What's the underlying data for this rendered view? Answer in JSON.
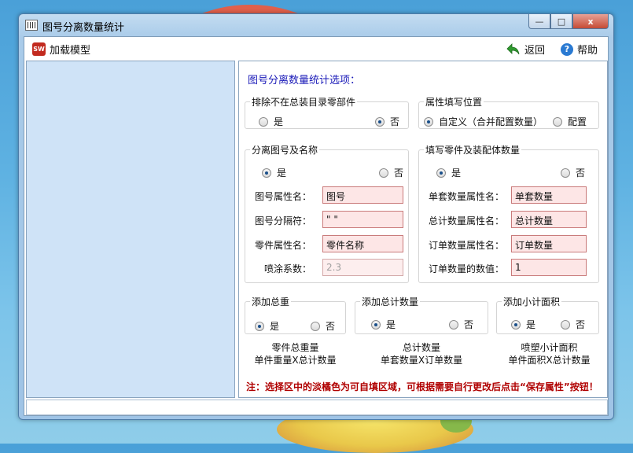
{
  "window": {
    "title": "图号分离数量统计",
    "minimize_glyph": "—",
    "maximize_glyph": "□",
    "close_glyph": "x"
  },
  "toolbar": {
    "load_model": "加载模型",
    "load_icon_text": "SW",
    "back": "返回",
    "help": "帮助",
    "help_icon_text": "?"
  },
  "options": {
    "heading": "图号分离数量统计选项：",
    "exclude": {
      "legend": "排除不在总装目录零部件",
      "yes": "是",
      "no": "否",
      "selected": "no"
    },
    "attr_position": {
      "legend": "属性填写位置",
      "custom": "自定义（合并配置数量）",
      "config": "配置",
      "selected": "custom"
    },
    "separate": {
      "legend": "分离图号及名称",
      "yes": "是",
      "no": "否",
      "selected": "yes",
      "drawing_attr_label": "图号属性名：",
      "drawing_attr_value": "图号",
      "separator_label": "图号分隔符：",
      "separator_value": "\" \"",
      "part_attr_label": "零件属性名：",
      "part_attr_value": "零件名称",
      "coating_label": "喷涂系数：",
      "coating_value": "2.3"
    },
    "fill_qty": {
      "legend": "填写零件及装配体数量",
      "yes": "是",
      "no": "否",
      "selected": "yes",
      "unit_qty_label": "单套数量属性名：",
      "unit_qty_value": "单套数量",
      "total_qty_label": "总计数量属性名：",
      "total_qty_value": "总计数量",
      "order_qty_label": "订单数量属性名：",
      "order_qty_value": "订单数量",
      "order_num_label": "订单数量的数值：",
      "order_num_value": "1"
    },
    "total_weight": {
      "legend": "添加总重",
      "yes": "是",
      "no": "否",
      "selected": "yes",
      "formula_1": "零件总重量",
      "formula_2": "单件重量X总计数量"
    },
    "total_count": {
      "legend": "添加总计数量",
      "yes": "是",
      "no": "否",
      "selected": "yes",
      "formula_1": "总计数量",
      "formula_2": "单套数量X订单数量"
    },
    "subtotal_area": {
      "legend": "添加小计面积",
      "yes": "是",
      "no": "否",
      "selected": "yes",
      "formula_1": "喷塑小计面积",
      "formula_2": "单件面积X总计数量"
    },
    "note": "注：选择区中的淡橘色为可自填区域，可根据需要自行更改后点击“保存属性”按钮！"
  }
}
